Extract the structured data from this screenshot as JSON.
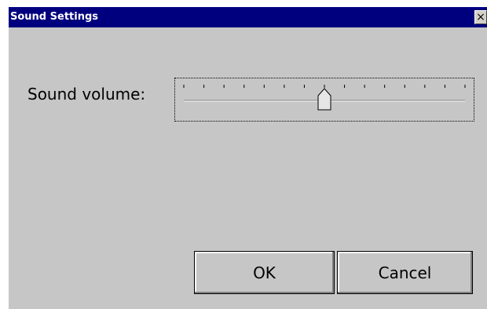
{
  "window": {
    "title": "Sound Settings",
    "close_label": "×"
  },
  "volume": {
    "label": "Sound volume:",
    "tick_count": 15,
    "value_fraction": 0.5
  },
  "buttons": {
    "ok": "OK",
    "cancel": "Cancel"
  },
  "colors": {
    "titlebar": "#00007f",
    "dialog_bg": "#c6c6c6"
  }
}
